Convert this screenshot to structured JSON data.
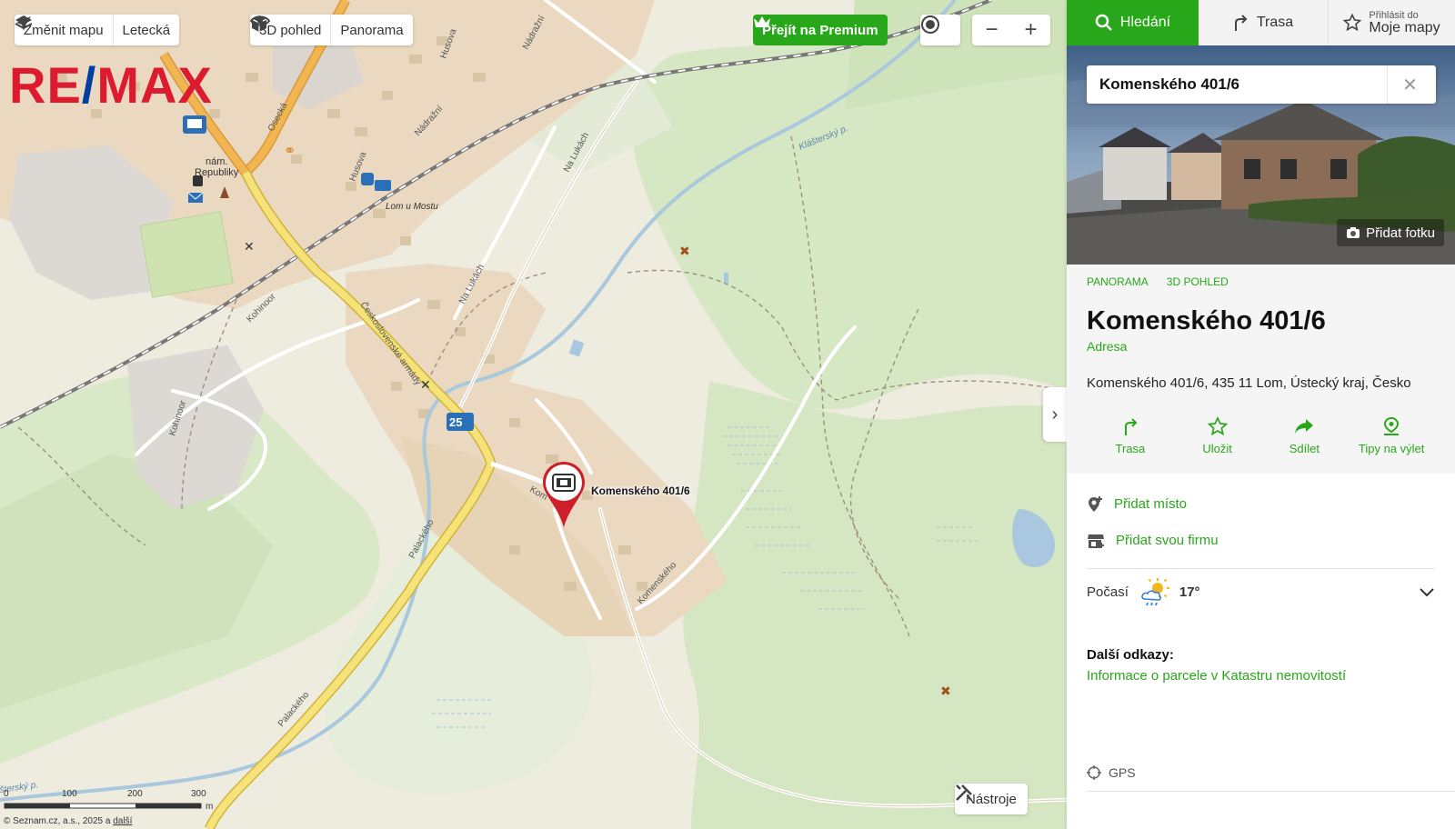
{
  "map": {
    "toolbar": {
      "change_map": "Změnit mapu",
      "aerial": "Letecká",
      "view_3d": "3D pohled",
      "panorama": "Panorama"
    },
    "premium": "Přejít na Premium",
    "zoom_out": "−",
    "zoom_in": "+",
    "logo": {
      "part1": "RE",
      "part2": "/",
      "part3": "MAX"
    },
    "tools": "Nástroje",
    "pin_label": "Komenského 401/6",
    "labels": {
      "square": "nám.\nRepubliky",
      "square_1": "nám.",
      "square_2": "Republiky",
      "station": "Lom u Mostu",
      "osecka": "Osecká",
      "husova1": "Husova",
      "husova2": "Husova",
      "nadrazni1": "Nádražní",
      "nadrazni2": "Nádražní",
      "na_lukach1": "Na Lukách",
      "na_lukach2": "Na Lukách",
      "klasterský": "Klášterský p.",
      "klasterský2": "šterský p.",
      "kohinoor1": "Kohinoor",
      "kohinoor2": "Kohinoor",
      "ceskoslovenske": "Československé armády",
      "palackeho1": "Palackého",
      "palackeho2": "Palackého",
      "komenskeho": "Komenského",
      "komenskeho_short": "Kom",
      "alsova": "Alšo",
      "slovakova": "Slo",
      "husova_top": "Husova",
      "nadrazni_top": "Nádražní",
      "mill": "Mill",
      "bus_num": "25"
    },
    "scale": {
      "t0": "0",
      "t1": "100",
      "t2": "200",
      "t3": "300",
      "unit": "m"
    },
    "copyright": "© Seznam.cz, a.s., 2025 a ",
    "copyright_link": "další"
  },
  "panel": {
    "tabs": {
      "search": "Hledání",
      "route": "Trasa",
      "login_small": "Přihlásit do",
      "login_big": "Moje mapy"
    },
    "search_value": "Komenského 401/6",
    "add_photo": "Přidat fotku",
    "photo_links": {
      "panorama": "PANORAMA",
      "view_3d": "3D POHLED"
    },
    "place": {
      "title": "Komenského 401/6",
      "type": "Adresa",
      "address": "Komenského 401/6, 435 11 Lom, Ústecký kraj, Česko"
    },
    "actions": {
      "route": "Trasa",
      "save": "Uložit",
      "share": "Sdílet",
      "tips": "Tipy na výlet"
    },
    "list": {
      "add_place": "Přidat místo",
      "add_company": "Přidat svou firmu"
    },
    "weather": {
      "label": "Počasí",
      "temp": "17°"
    },
    "links": {
      "head": "Další odkazy:",
      "cadastre": "Informace o parcele v Katastru nemovitostí"
    },
    "gps": "GPS"
  },
  "colors": {
    "accent_green": "#29a71a",
    "remax_red": "#dc1c2e",
    "remax_blue": "#003da5",
    "pin_red": "#cc1f2a"
  }
}
